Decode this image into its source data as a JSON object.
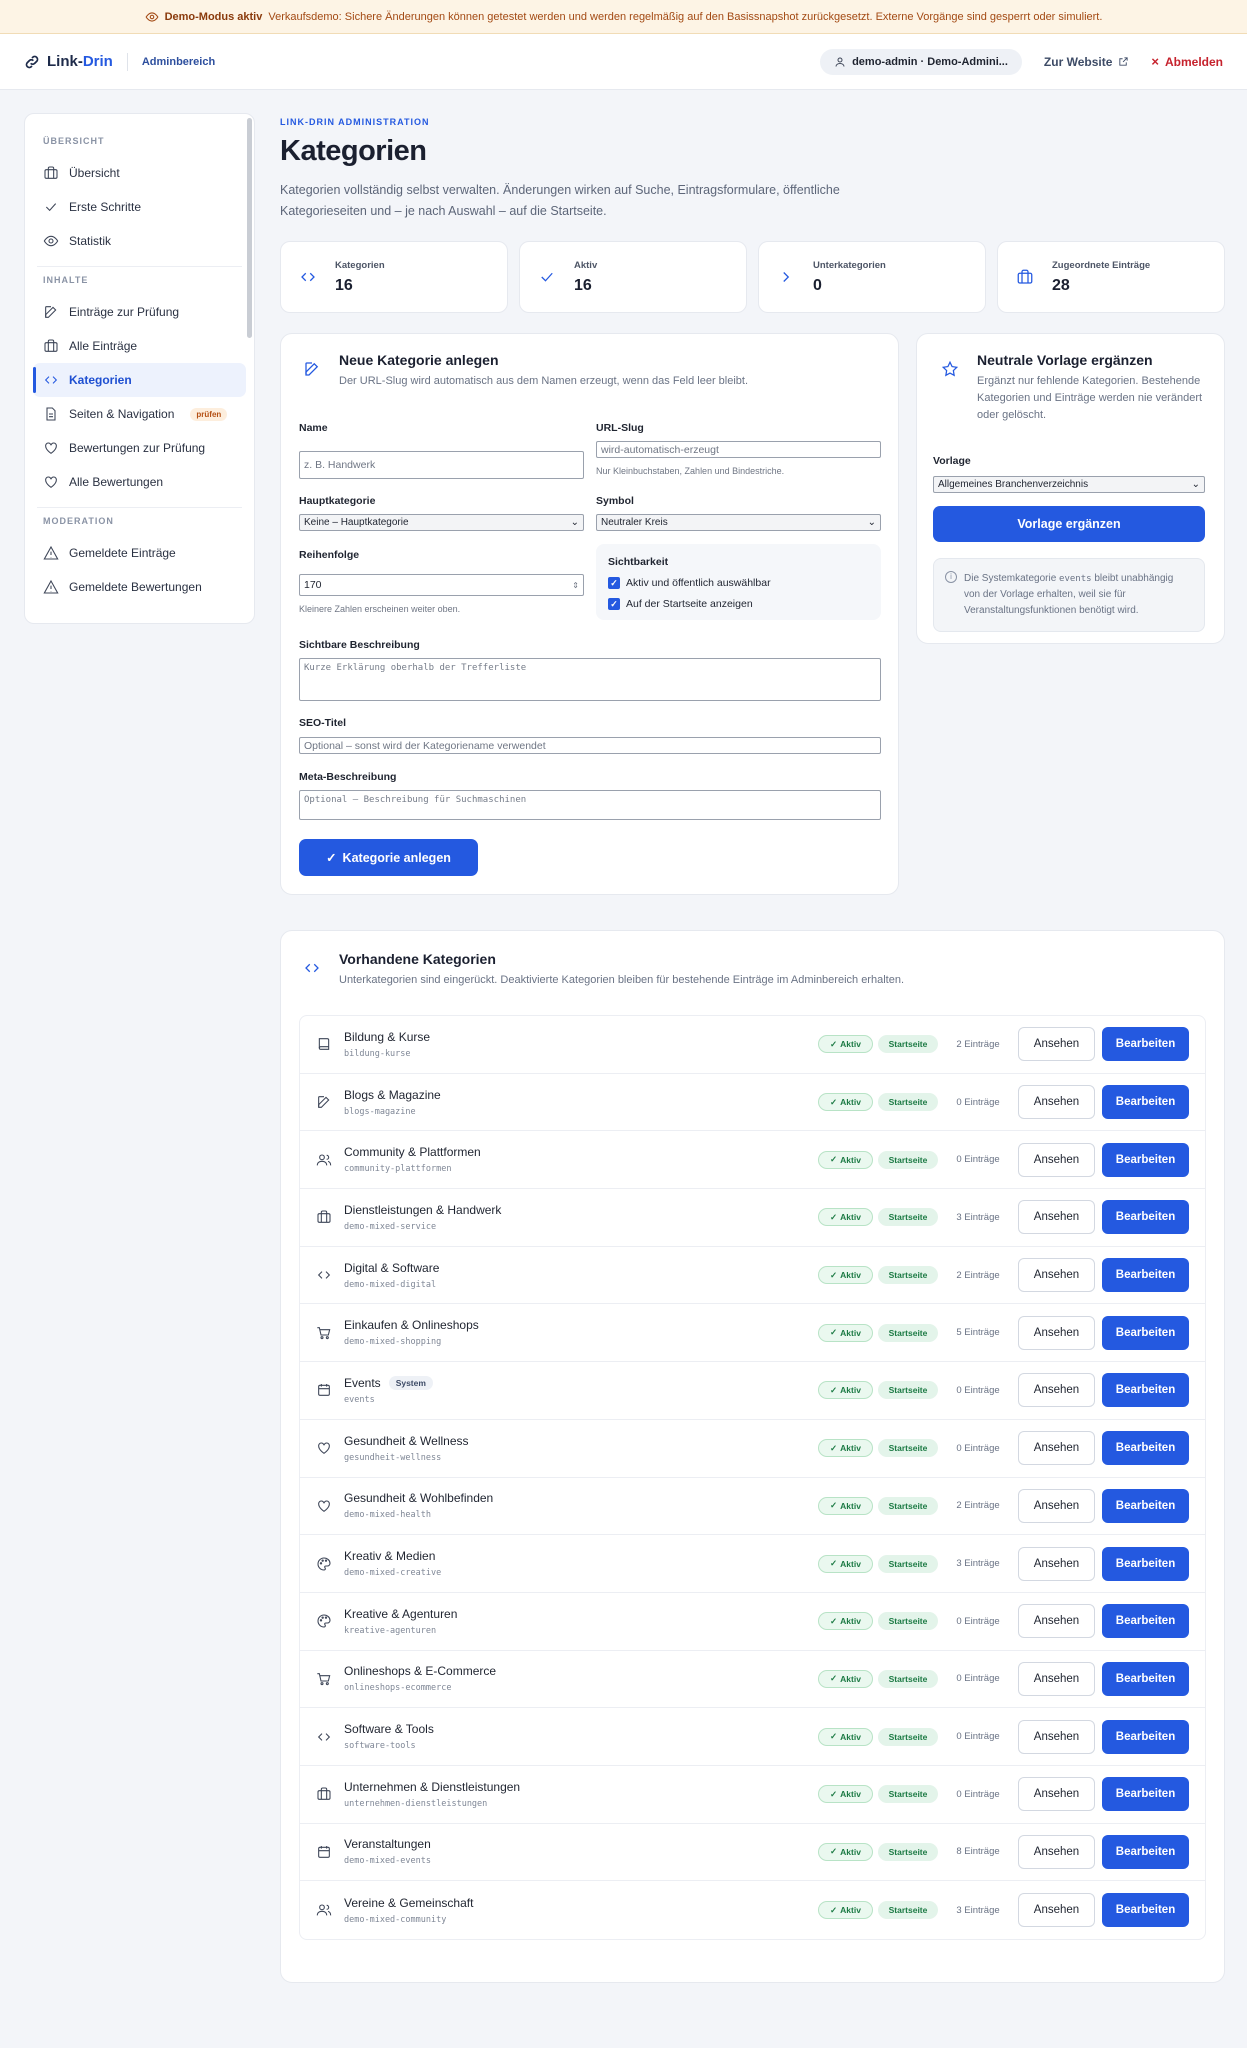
{
  "banner": {
    "title": "Demo-Modus aktiv",
    "text": "Verkaufsdemo: Sichere Änderungen können getestet werden und werden regelmäßig auf den Basissnapshot zurückgesetzt. Externe Vorgänge sind gesperrt oder simuliert."
  },
  "topbar": {
    "brand_a": "Link-",
    "brand_b": "Drin",
    "area": "Adminbereich",
    "user": "demo-admin · Demo-Admini...",
    "website": "Zur Website",
    "logout": "Abmelden"
  },
  "sidebar": {
    "sections": [
      {
        "heading": "ÜBERSICHT",
        "items": [
          {
            "label": "Übersicht",
            "icon": "briefcase-icon"
          },
          {
            "label": "Erste Schritte",
            "icon": "check-icon"
          },
          {
            "label": "Statistik",
            "icon": "eye-icon"
          }
        ]
      },
      {
        "heading": "INHALTE",
        "items": [
          {
            "label": "Einträge zur Prüfung",
            "icon": "edit-icon"
          },
          {
            "label": "Alle Einträge",
            "icon": "briefcase-icon"
          },
          {
            "label": "Kategorien",
            "icon": "code-icon",
            "active": true
          },
          {
            "label": "Seiten & Navigation",
            "icon": "document-icon",
            "badge": "prüfen"
          },
          {
            "label": "Bewertungen zur Prüfung",
            "icon": "heart-icon"
          },
          {
            "label": "Alle Bewertungen",
            "icon": "heart-icon"
          }
        ]
      },
      {
        "heading": "MODERATION",
        "items": [
          {
            "label": "Gemeldete Einträge",
            "icon": "warning-icon"
          },
          {
            "label": "Gemeldete Bewertungen",
            "icon": "warning-icon"
          }
        ]
      }
    ]
  },
  "header": {
    "eyebrow": "LINK-DRIN ADMINISTRATION",
    "title": "Kategorien",
    "intro": "Kategorien vollständig selbst verwalten. Änderungen wirken auf Suche, Eintragsformulare, öffentliche Kategorieseiten und – je nach Auswahl – auf die Startseite."
  },
  "stats": [
    {
      "label": "Kategorien",
      "value": "16",
      "icon": "code-icon"
    },
    {
      "label": "Aktiv",
      "value": "16",
      "icon": "check-icon"
    },
    {
      "label": "Unterkategorien",
      "value": "0",
      "icon": "chevron-right-icon"
    },
    {
      "label": "Zugeordnete Einträge",
      "value": "28",
      "icon": "briefcase-icon"
    }
  ],
  "new_form": {
    "title": "Neue Kategorie anlegen",
    "subtitle": "Der URL-Slug wird automatisch aus dem Namen erzeugt, wenn das Feld leer bleibt.",
    "name_label": "Name",
    "name_placeholder": "z. B. Handwerk",
    "slug_label": "URL-Slug",
    "slug_placeholder": "wird-automatisch-erzeugt",
    "slug_hint": "Nur Kleinbuchstaben, Zahlen und Bindestriche.",
    "parent_label": "Hauptkategorie",
    "parent_value": "Keine – Hauptkategorie",
    "symbol_label": "Symbol",
    "symbol_value": "Neutraler Kreis",
    "order_label": "Reihenfolge",
    "order_value": "170",
    "order_hint": "Kleinere Zahlen erscheinen weiter oben.",
    "visibility_label": "Sichtbarkeit",
    "check1": "Aktiv und öffentlich auswählbar",
    "check2": "Auf der Startseite anzeigen",
    "desc_label": "Sichtbare Beschreibung",
    "desc_placeholder": "Kurze Erklärung oberhalb der Trefferliste",
    "seo_label": "SEO-Titel",
    "seo_placeholder": "Optional – sonst wird der Kategoriename verwendet",
    "meta_label": "Meta-Beschreibung",
    "meta_placeholder": "Optional – Beschreibung für Suchmaschinen",
    "submit": "Kategorie anlegen"
  },
  "template_card": {
    "title": "Neutrale Vorlage ergänzen",
    "subtitle": "Ergänzt nur fehlende Kategorien. Bestehende Kategorien und Einträge werden nie verändert oder gelöscht.",
    "template_label": "Vorlage",
    "template_value": "Allgemeines Branchenverzeichnis",
    "button": "Vorlage ergänzen",
    "info_a": "Die Systemkategorie",
    "info_code": "events",
    "info_b": "bleibt unabhängig von der Vorlage erhalten, weil sie für Veranstaltungsfunktionen benötigt wird."
  },
  "list": {
    "title": "Vorhandene Kategorien",
    "subtitle": "Unterkategorien sind eingerückt. Deaktivierte Kategorien bleiben für bestehende Einträge im Adminbereich erhalten.",
    "status_label": "Aktiv",
    "start_label": "Startseite",
    "view_label": "Ansehen",
    "edit_label": "Bearbeiten",
    "rows": [
      {
        "name": "Bildung & Kurse",
        "slug": "bildung-kurse",
        "count": "2 Einträge",
        "icon": "book-icon"
      },
      {
        "name": "Blogs & Magazine",
        "slug": "blogs-magazine",
        "count": "0 Einträge",
        "icon": "edit-icon"
      },
      {
        "name": "Community & Plattformen",
        "slug": "community-plattformen",
        "count": "0 Einträge",
        "icon": "users-icon"
      },
      {
        "name": "Dienstleistungen & Handwerk",
        "slug": "demo-mixed-service",
        "count": "3 Einträge",
        "icon": "briefcase-icon"
      },
      {
        "name": "Digital & Software",
        "slug": "demo-mixed-digital",
        "count": "2 Einträge",
        "icon": "code-icon"
      },
      {
        "name": "Einkaufen & Onlineshops",
        "slug": "demo-mixed-shopping",
        "count": "5 Einträge",
        "icon": "cart-icon"
      },
      {
        "name": "Events",
        "slug": "events",
        "count": "0 Einträge",
        "icon": "calendar-icon",
        "badge": "System"
      },
      {
        "name": "Gesundheit & Wellness",
        "slug": "gesundheit-wellness",
        "count": "0 Einträge",
        "icon": "heart-icon"
      },
      {
        "name": "Gesundheit & Wohlbefinden",
        "slug": "demo-mixed-health",
        "count": "2 Einträge",
        "icon": "heart-icon"
      },
      {
        "name": "Kreativ & Medien",
        "slug": "demo-mixed-creative",
        "count": "3 Einträge",
        "icon": "palette-icon"
      },
      {
        "name": "Kreative & Agenturen",
        "slug": "kreative-agenturen",
        "count": "0 Einträge",
        "icon": "palette-icon"
      },
      {
        "name": "Onlineshops & E-Commerce",
        "slug": "onlineshops-ecommerce",
        "count": "0 Einträge",
        "icon": "cart-icon"
      },
      {
        "name": "Software & Tools",
        "slug": "software-tools",
        "count": "0 Einträge",
        "icon": "code-icon"
      },
      {
        "name": "Unternehmen & Dienstleistungen",
        "slug": "unternehmen-dienstleistungen",
        "count": "0 Einträge",
        "icon": "briefcase-icon"
      },
      {
        "name": "Veranstaltungen",
        "slug": "demo-mixed-events",
        "count": "8 Einträge",
        "icon": "calendar-icon"
      },
      {
        "name": "Vereine & Gemeinschaft",
        "slug": "demo-mixed-community",
        "count": "3 Einträge",
        "icon": "users-icon"
      }
    ]
  },
  "colors": {
    "accent": "#2459e0",
    "banner_bg": "#fdf4e5",
    "success": "#1c7a44",
    "danger": "#c6222d"
  }
}
